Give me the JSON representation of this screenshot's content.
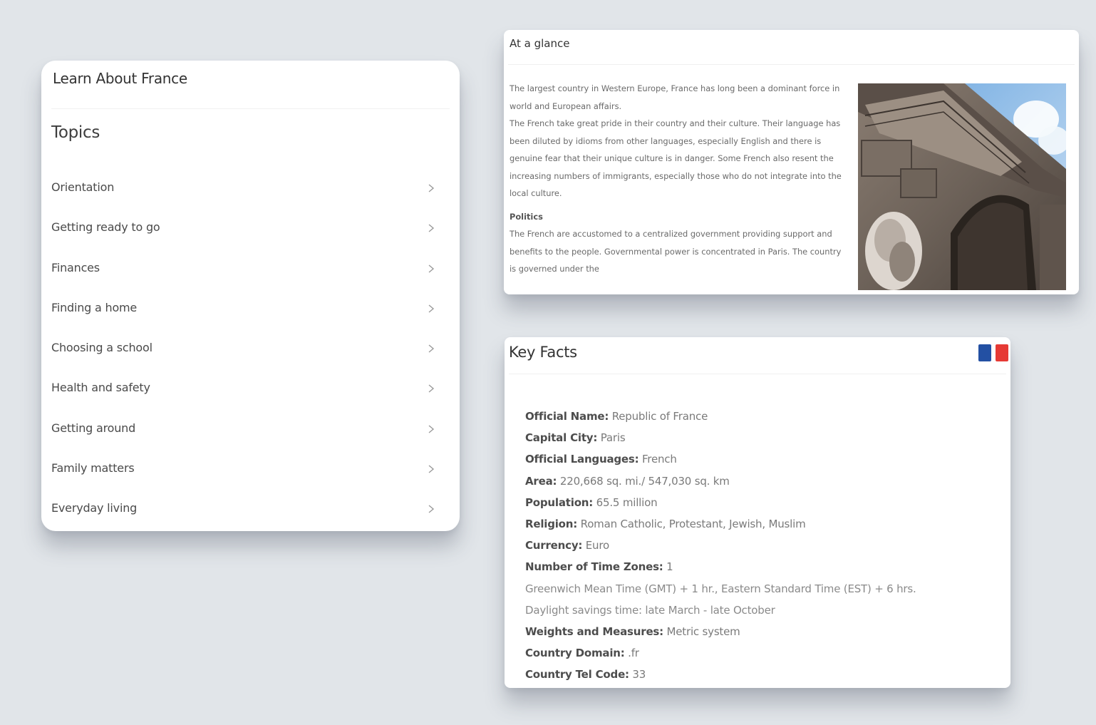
{
  "learn_card": {
    "title": "Learn About France",
    "topics_heading": "Topics",
    "topics": [
      {
        "label": "Orientation"
      },
      {
        "label": "Getting ready to go"
      },
      {
        "label": "Finances"
      },
      {
        "label": "Finding a home"
      },
      {
        "label": "Choosing a school"
      },
      {
        "label": "Health and safety"
      },
      {
        "label": "Getting around"
      },
      {
        "label": "Family matters"
      },
      {
        "label": "Everyday living"
      }
    ],
    "chevron_icon": "chevron-right-icon"
  },
  "glance_card": {
    "title": "At a glance",
    "paragraph_1": "The largest country in Western Europe, France has long been a dominant force in world and European affairs.",
    "paragraph_2": "The French take great pride in their country and their culture. Their language has been diluted by idioms from other languages, especially English and there is genuine fear that their unique culture is in danger. Some French also resent the increasing numbers of immigrants, especially those who do not integrate into the local culture.",
    "politics_heading": "Politics",
    "politics_text": "The French are accustomed to a centralized government providing support and benefits to the people. Governmental power is concentrated in Paris. The country is governed under the",
    "image_subject": "Arc de Triomphe photo"
  },
  "facts_card": {
    "title": "Key Facts",
    "flag_icon": "france-flag-icon",
    "flag_colors": {
      "blue": "#2350a3",
      "red": "#e63a35"
    },
    "facts": [
      {
        "label": "Official Name:",
        "value": " Republic of France"
      },
      {
        "label": "Capital City:",
        "value": " Paris"
      },
      {
        "label": "Official Languages:",
        "value": " French"
      },
      {
        "label": "Area:",
        "value": " 220,668 sq. mi./ 547,030 sq. km"
      },
      {
        "label": "Population:",
        "value": " 65.5 million"
      },
      {
        "label": "Religion:",
        "value": " Roman Catholic, Protestant, Jewish, Muslim"
      },
      {
        "label": "Currency:",
        "value": " Euro"
      },
      {
        "label": "Number of Time Zones:",
        "value": " 1"
      }
    ],
    "timezone_note": "Greenwich Mean Time (GMT) + 1 hr., Eastern Standard Time (EST) + 6 hrs.",
    "daylight_note": "Daylight savings time: late March - late October",
    "facts_after": [
      {
        "label": "Weights and Measures:",
        "value": " Metric system"
      },
      {
        "label": "Country Domain:",
        "value": " .fr"
      },
      {
        "label": "Country Tel Code:",
        "value": " 33"
      }
    ]
  }
}
